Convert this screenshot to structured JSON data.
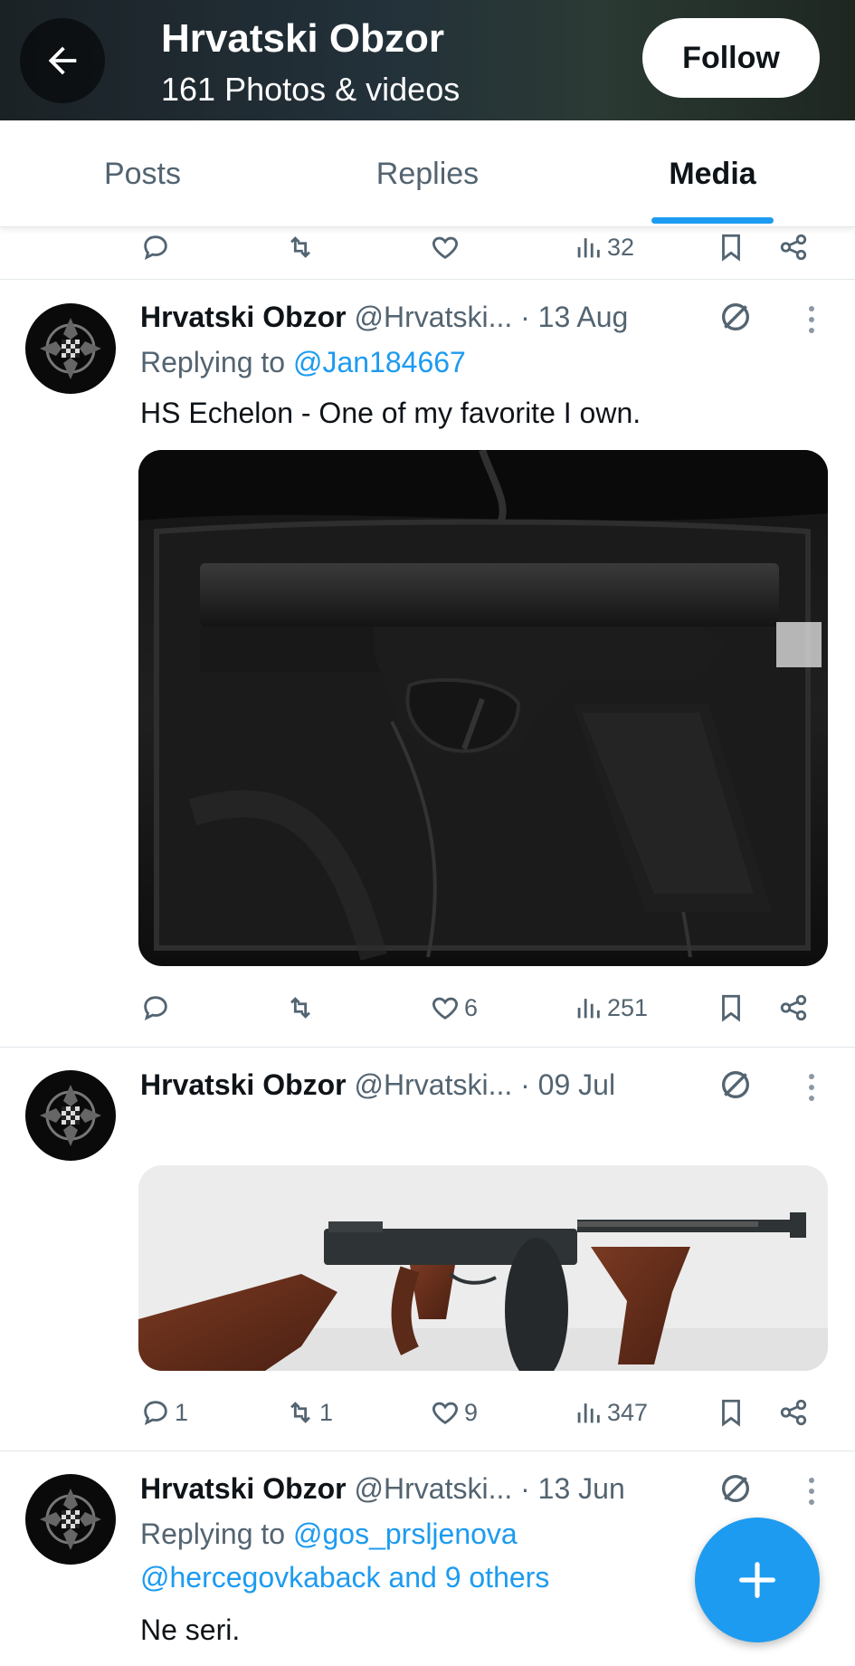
{
  "header": {
    "title": "Hrvatski Obzor",
    "subtitle": "161 Photos & videos",
    "follow_label": "Follow",
    "back_icon": "arrow-left-icon"
  },
  "tabs": [
    {
      "label": "Posts",
      "active": false
    },
    {
      "label": "Replies",
      "active": false
    },
    {
      "label": "Media",
      "active": true
    }
  ],
  "top_actions": {
    "reply": "",
    "repost": "",
    "like": "",
    "views": "32"
  },
  "tweets": [
    {
      "name": "Hrvatski Obzor",
      "handle": "@Hrvatski...",
      "time": "· 13 Aug",
      "replying_prefix": "Replying to",
      "replying_to": "@Jan184667",
      "text": "HS Echelon - One of my favorite I own.",
      "media_desc": "pistol-photo",
      "actions": {
        "reply": "",
        "repost": "",
        "like": "6",
        "views": "251"
      }
    },
    {
      "name": "Hrvatski Obzor",
      "handle": "@Hrvatski...",
      "time": "· 09 Jul",
      "media_desc": "submachine-gun-photo",
      "actions": {
        "reply": "1",
        "repost": "1",
        "like": "9",
        "views": "347"
      }
    },
    {
      "name": "Hrvatski Obzor",
      "handle": "@Hrvatski...",
      "time": "· 13 Jun",
      "replying_prefix": "Replying to",
      "replying_to": "@gos_prsljenova",
      "replying_to_2": "@hercegovkaback and 9 others",
      "text": "Ne seri."
    }
  ],
  "fab": {
    "icon": "plus-icon"
  },
  "colors": {
    "accent": "#1d9bf0",
    "text": "#0f1419",
    "muted": "#536471"
  }
}
